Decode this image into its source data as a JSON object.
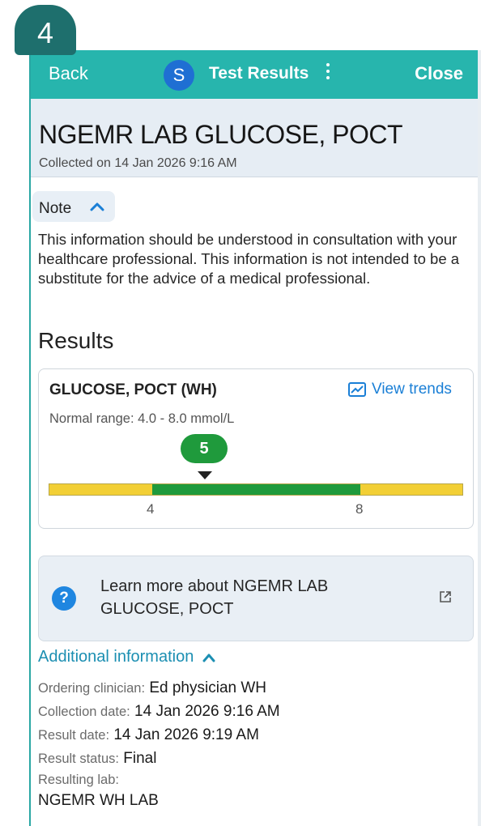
{
  "step_badge": "4",
  "topbar": {
    "back_label": "Back",
    "avatar_initial": "S",
    "title": "Test Results",
    "close_label": "Close"
  },
  "header": {
    "title": "NGEMR LAB GLUCOSE, POCT",
    "collected": "Collected on 14 Jan 2026 9:16 AM"
  },
  "note": {
    "label": "Note",
    "text": "This information should be understood in consultation with your healthcare professional. This information is not intended to be a substitute for the advice of a medical professional."
  },
  "results": {
    "heading": "Results",
    "test_name": "GLUCOSE, POCT (WH)",
    "view_trends_label": "View trends",
    "normal_range": "Normal range: 4.0 - 8.0 mmol/L",
    "value": "5",
    "range_low": "4",
    "range_high": "8",
    "colors": {
      "in_range": "#1f9a3c",
      "out_of_range": "#f2cf35"
    }
  },
  "learn_more": {
    "text": "Learn more about NGEMR LAB GLUCOSE, POCT"
  },
  "additional_info": {
    "toggle_label": "Additional information",
    "ordering_clinician_label": "Ordering clinician:",
    "ordering_clinician": "Ed physician WH",
    "collection_date_label": "Collection date:",
    "collection_date": "14 Jan 2026 9:16 AM",
    "result_date_label": "Result date:",
    "result_date": "14 Jan 2026 9:19 AM",
    "result_status_label": "Result status:",
    "result_status": "Final",
    "resulting_lab_label": "Resulting lab:",
    "resulting_lab": "NGEMR WH LAB"
  },
  "theme": {
    "accent": "#27b5ad",
    "link": "#1a7fd6"
  }
}
